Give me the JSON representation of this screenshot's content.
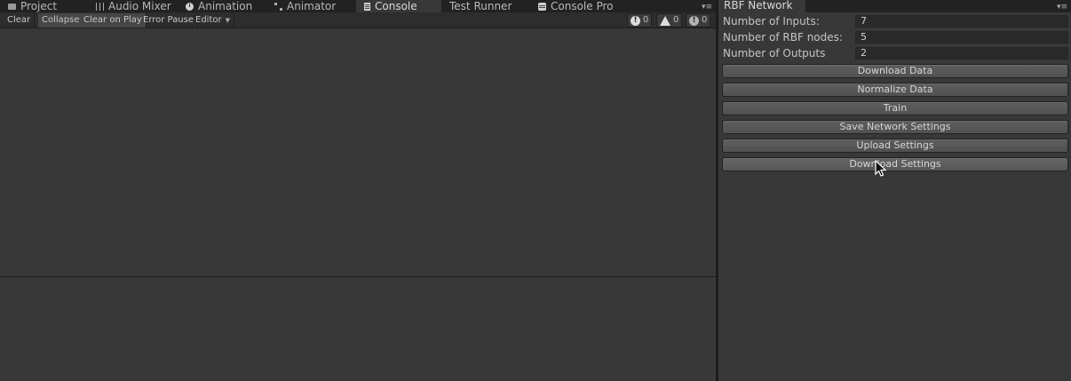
{
  "left_tabs": [
    {
      "label": "Project",
      "icon": "folder-icon"
    },
    {
      "label": "Audio Mixer",
      "icon": "mixer-icon"
    },
    {
      "label": "Animation",
      "icon": "clock-icon"
    },
    {
      "label": "Animator",
      "icon": "animator-icon"
    },
    {
      "label": "Console",
      "icon": "console-icon",
      "active": true
    },
    {
      "label": "Test Runner"
    },
    {
      "label": "Console Pro",
      "icon": "console-pro-icon"
    }
  ],
  "toolbar": {
    "clear": "Clear",
    "collapse": "Collapse",
    "clear_on_play": "Clear on Play",
    "error_pause": "Error Pause",
    "editor": "Editor",
    "error_count": "0",
    "warning_count": "0",
    "message_count": "0"
  },
  "rbf": {
    "tab_title": "RBF Network",
    "fields": [
      {
        "label": "Number of Inputs:",
        "value": "7"
      },
      {
        "label": "Number of RBF nodes:",
        "value": "5"
      },
      {
        "label": "Number of Outputs",
        "value": "2"
      }
    ],
    "buttons": [
      "Download Data",
      "Normalize Data",
      "Train",
      "Save Network Settings",
      "Upload Settings",
      "Download Settings"
    ]
  },
  "colors": {
    "background": "#383838",
    "tabbar": "#222222",
    "button": "#575757"
  }
}
